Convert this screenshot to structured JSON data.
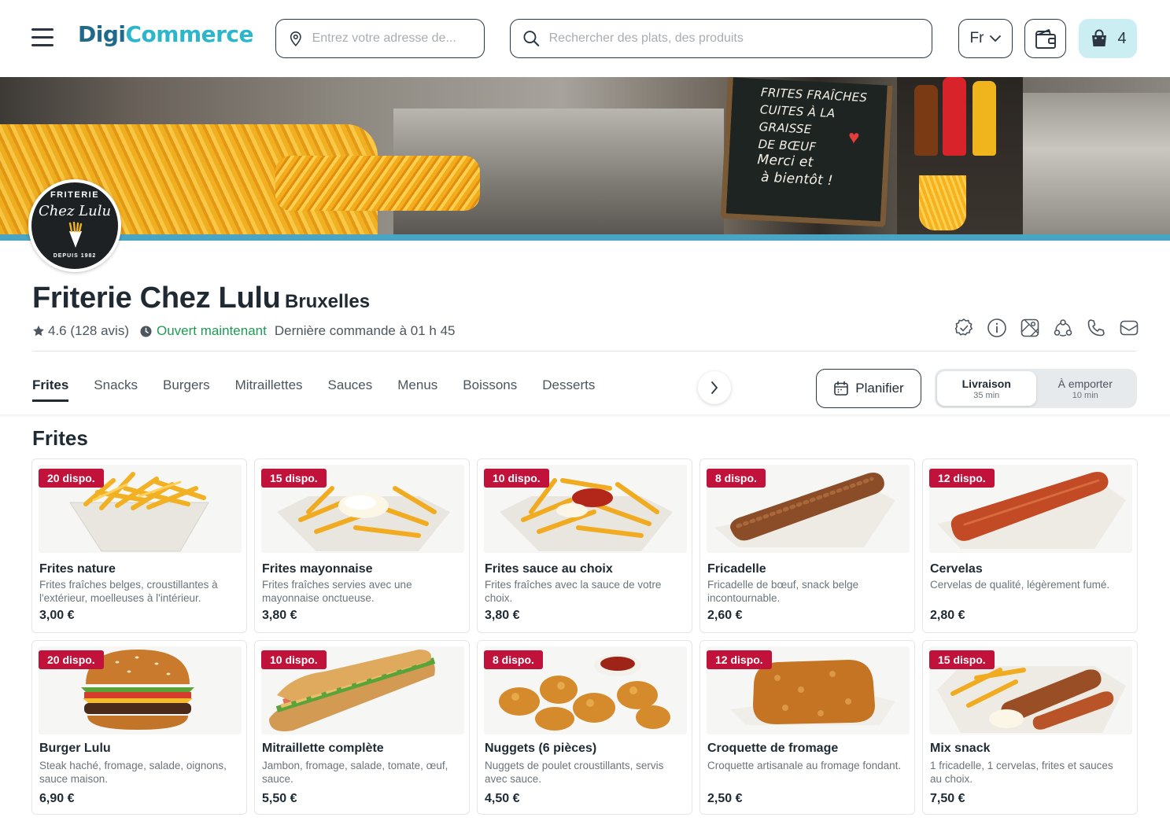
{
  "header": {
    "logo_part1": "Digi",
    "logo_part2": "Commerce",
    "address_placeholder": "Entrez votre adresse de...",
    "search_placeholder": "Rechercher des plats, des produits",
    "language": "Fr",
    "cart_count": "4"
  },
  "banner": {
    "board_line1": "FRITES FRAÎCHES",
    "board_line2": "CUITES À LA GRAISSE",
    "board_line3": "DE BŒUF",
    "board_line4": "Merci et",
    "board_line5": "à bientôt !"
  },
  "store_logo": {
    "top": "FRITERIE",
    "name": "Chez Lulu",
    "bottom": "DEPUIS 1982"
  },
  "store": {
    "name": "Friterie Chez Lulu",
    "city": "Bruxelles",
    "rating": "4.6 (128 avis)",
    "status": "Ouvert maintenant",
    "last_order": "Dernière commande à 01 h 45",
    "colors": {
      "open": "#1e9b53",
      "stock_badge": "#c0123a",
      "brand_dark": "#1f6a8a",
      "brand_light": "#2cb6c9"
    }
  },
  "tabs": [
    "Frites",
    "Snacks",
    "Burgers",
    "Mitraillettes",
    "Sauces",
    "Menus",
    "Boissons",
    "Desserts"
  ],
  "actions": {
    "plan_label": "Planifier",
    "delivery_label": "Livraison",
    "delivery_time": "35 min",
    "takeaway_label": "À emporter",
    "takeaway_time": "10 min"
  },
  "section_title": "Frites",
  "products": [
    {
      "stock": "20 dispo.",
      "name": "Frites nature",
      "desc": "Frites fraîches belges, croustillantes à l'extérieur, moelleuses à l'intérieur.",
      "price": "3,00 €",
      "image": "fries"
    },
    {
      "stock": "15 dispo.",
      "name": "Frites mayonnaise",
      "desc": "Frites fraîches servies avec une mayonnaise onctueuse.",
      "price": "3,80 €",
      "image": "fries-mayo"
    },
    {
      "stock": "10 dispo.",
      "name": "Frites sauce au choix",
      "desc": "Frites fraîches avec la sauce de votre choix.",
      "price": "3,80 €",
      "image": "fries-sauce"
    },
    {
      "stock": "8 dispo.",
      "name": "Fricadelle",
      "desc": "Fricadelle de bœuf, snack belge incontournable.",
      "price": "2,60 €",
      "image": "fricadelle"
    },
    {
      "stock": "12 dispo.",
      "name": "Cervelas",
      "desc": "Cervelas de qualité, légèrement fumé.",
      "price": "2,80 €",
      "image": "cervelas"
    },
    {
      "stock": "20 dispo.",
      "name": "Burger Lulu",
      "desc": "Steak haché, fromage, salade, oignons, sauce maison.",
      "price": "6,90 €",
      "image": "burger"
    },
    {
      "stock": "10 dispo.",
      "name": "Mitraillette complète",
      "desc": "Jambon, fromage, salade, tomate, œuf, sauce.",
      "price": "5,50 €",
      "image": "sandwich"
    },
    {
      "stock": "8 dispo.",
      "name": "Nuggets (6 pièces)",
      "desc": "Nuggets de poulet croustillants, servis avec sauce.",
      "price": "4,50 €",
      "image": "nuggets"
    },
    {
      "stock": "12 dispo.",
      "name": "Croquette de fromage",
      "desc": "Croquette artisanale au fromage fondant.",
      "price": "2,50 €",
      "image": "croquette"
    },
    {
      "stock": "15 dispo.",
      "name": "Mix snack",
      "desc": "1 fricadelle, 1 cervelas, frites et sauces au choix.",
      "price": "7,50 €",
      "image": "mix-snack"
    }
  ]
}
